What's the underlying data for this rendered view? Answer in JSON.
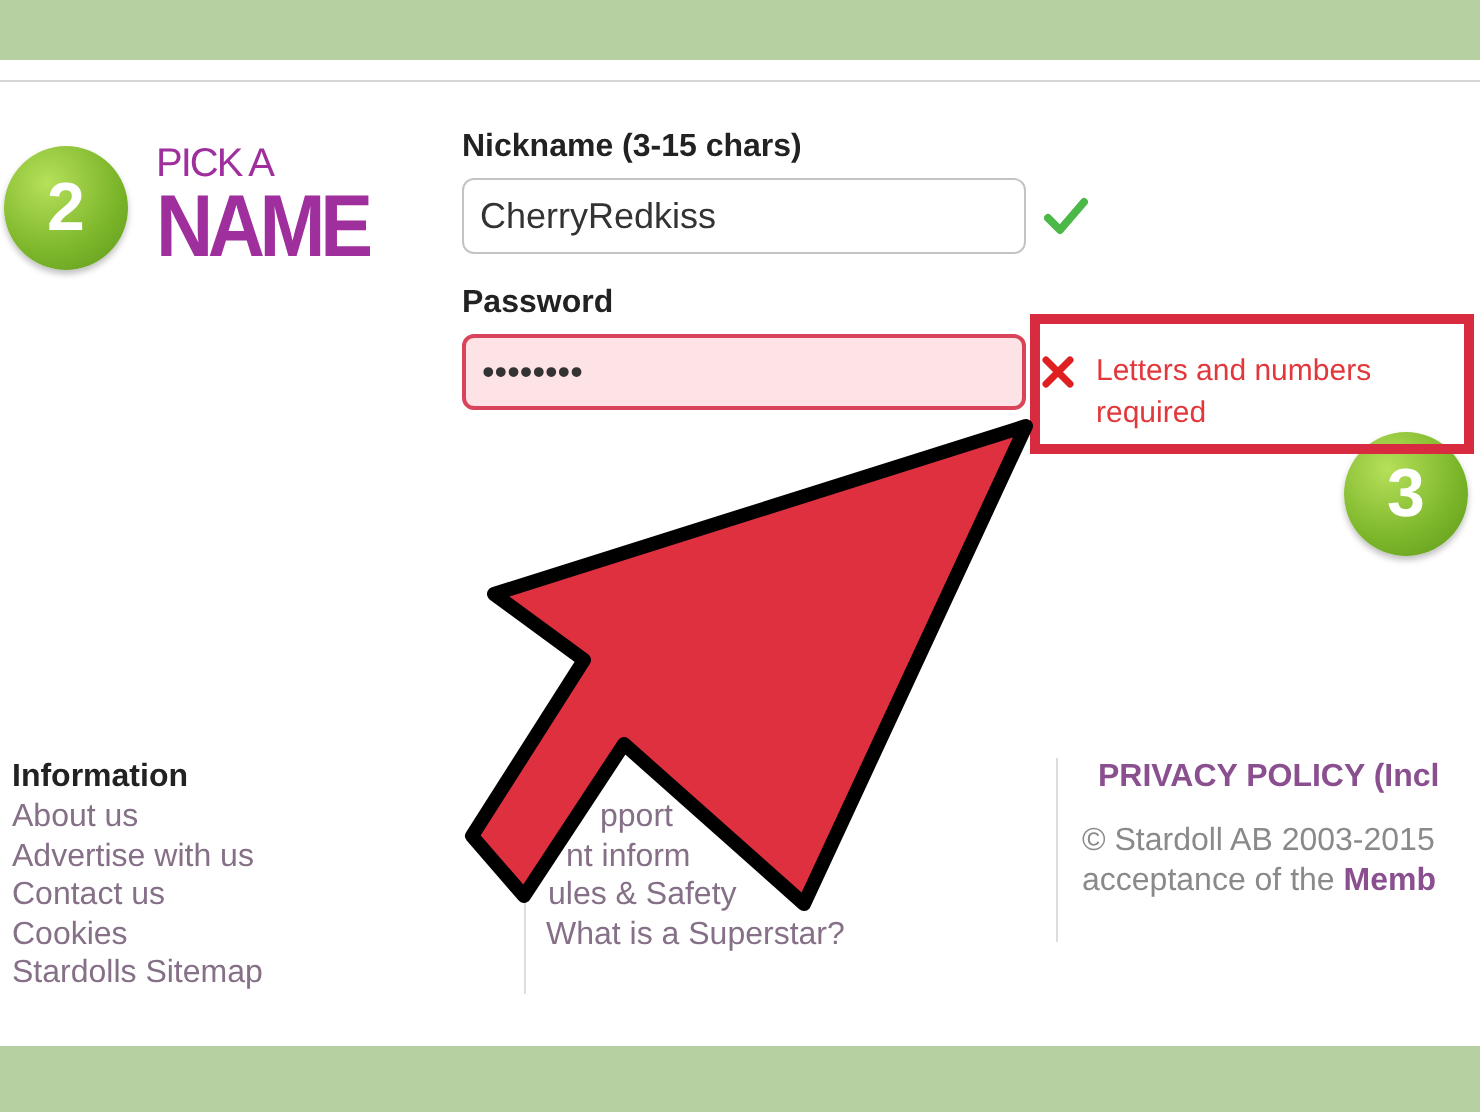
{
  "step_badge": {
    "number": "2"
  },
  "heading": {
    "line_1": "PICK A",
    "line_2": "NAME"
  },
  "nickname": {
    "label": "Nickname (3-15 chars)",
    "value": "CherryRedkiss",
    "valid": true
  },
  "password": {
    "label": "Password",
    "value": "••••••••",
    "valid": false,
    "error": "Letters and numbers required"
  },
  "annotation": {
    "step_number": "3"
  },
  "footer": {
    "columns": [
      {
        "kind": "links",
        "heading": "Information",
        "items": [
          "About us",
          "Advertise with us",
          "Contact us",
          "Cookies",
          "Stardolls Sitemap"
        ]
      },
      {
        "kind": "links",
        "items": [
          "pport",
          "nt inform",
          "ules & Safety",
          "What is a Superstar?"
        ]
      },
      {
        "kind": "legal",
        "heading": "PRIVACY POLICY (Incl",
        "items": [
          "© Stardoll AB 2003-2015",
          "acceptance of the **Memb**"
        ]
      }
    ]
  }
}
